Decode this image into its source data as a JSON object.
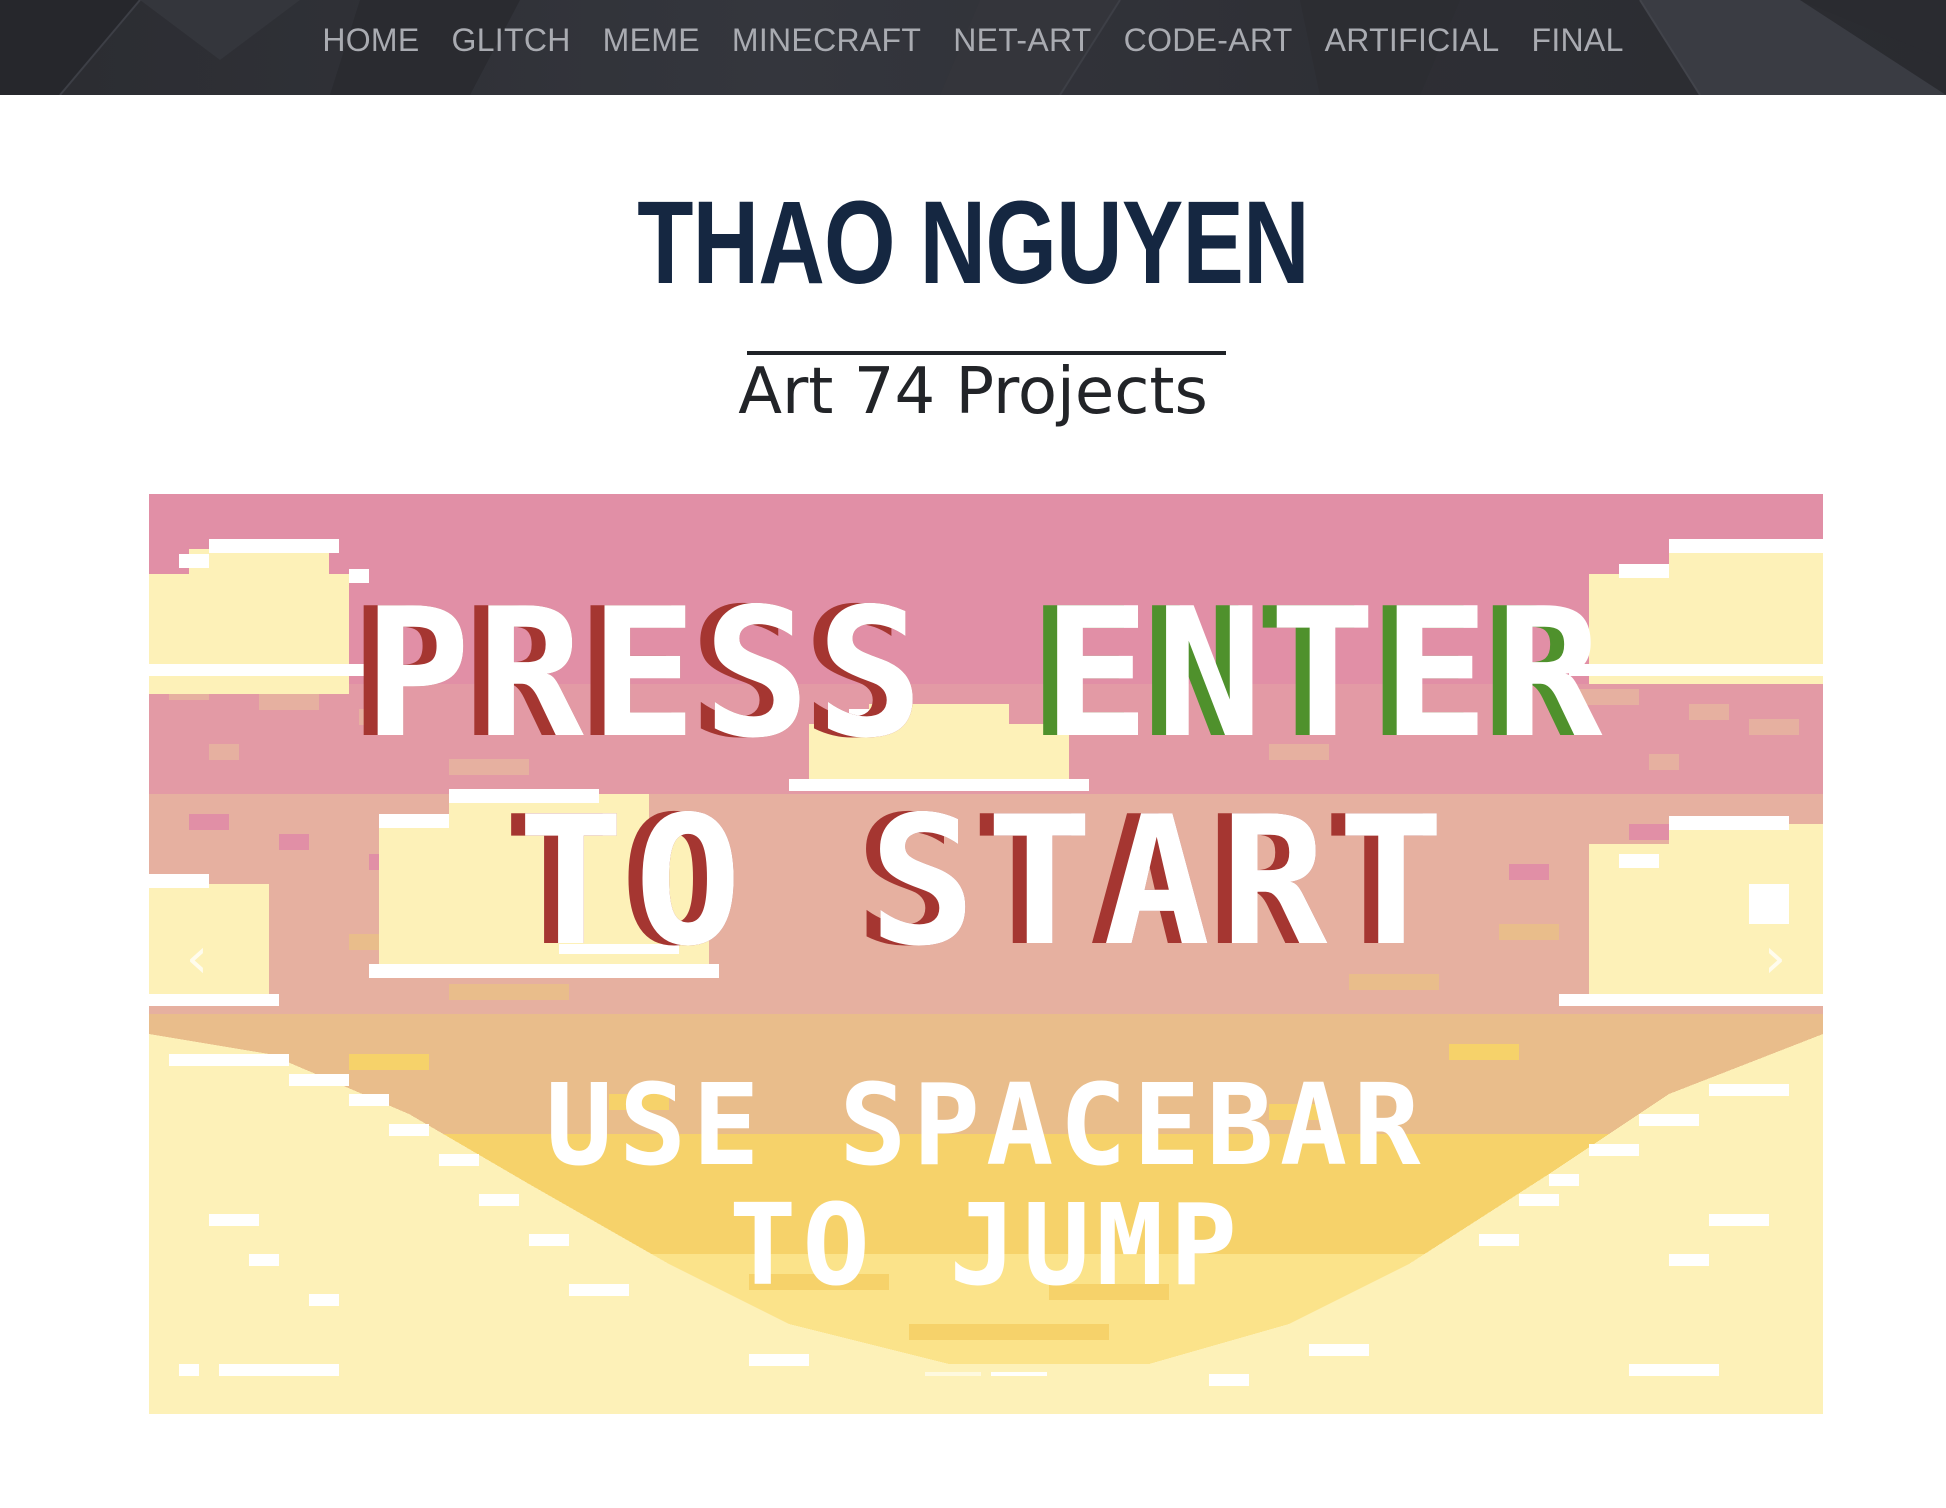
{
  "nav": {
    "items": [
      {
        "label": "HOME"
      },
      {
        "label": "GLITCH"
      },
      {
        "label": "MEME"
      },
      {
        "label": "MINECRAFT"
      },
      {
        "label": "NET-ART"
      },
      {
        "label": "CODE-ART"
      },
      {
        "label": "ARTIFICIAL"
      },
      {
        "label": "FINAL"
      }
    ]
  },
  "header": {
    "title": "THAO NGUYEN",
    "subtitle": "Art 74 Projects"
  },
  "carousel": {
    "slide": {
      "line1_part1": "PRESS",
      "line1_part2": "ENTER",
      "line2": "TO START",
      "line3": "USE SPACEBAR",
      "line4": "TO JUMP"
    },
    "prev_icon": "chevron-left-icon",
    "next_icon": "chevron-right-icon",
    "prev_glyph": "‹",
    "next_glyph": "›",
    "slide_count": 2,
    "active_slide": 1
  },
  "colors": {
    "nav_bg": "#2e2f35",
    "nav_text": "#a9abb1",
    "title": "#152741",
    "sky_pink": "#e18fa6",
    "sky_peach": "#e6b0a0",
    "sand": "#e9bd8b",
    "yellow": "#f6d26a",
    "cream": "#fdf1b8",
    "text_red": "#a53631",
    "text_green": "#4f912c"
  }
}
